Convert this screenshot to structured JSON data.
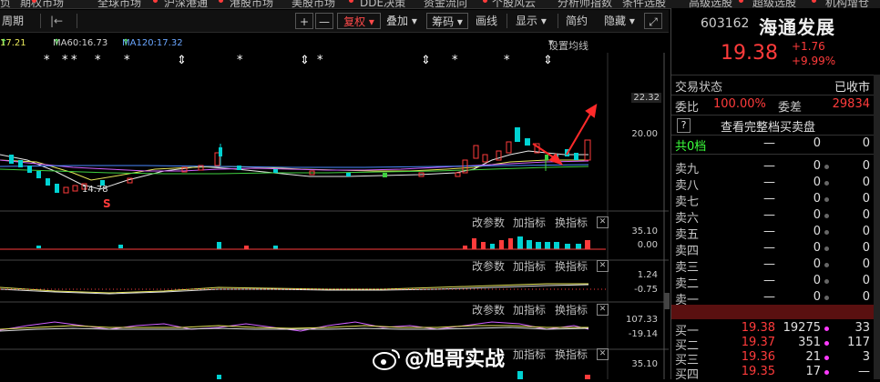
{
  "colors": {
    "up": "#ff3b3b",
    "down": "#00d2d2",
    "bg": "#000000",
    "accent": "#ff3b3b",
    "fall": "#3bff3b"
  },
  "top_nav": {
    "items": [
      "负",
      "期权市场",
      "全球市场",
      "沪深港通",
      "港股市场",
      "美股市场",
      "DDE决策",
      "资金流向",
      "个股风云",
      "分析师指数",
      "条件选股",
      "高级选股",
      "超级选股",
      "机构增仓"
    ]
  },
  "toolbar": {
    "period": "周期",
    "prev": "|←",
    "plus": "+",
    "minus": "—",
    "fuquan": "复权",
    "diejia": "叠加",
    "choumа": "筹码",
    "huaxian": "画线",
    "xianshi": "显示",
    "jianyue": "简约",
    "yincang": "隐藏",
    "expand_icon": "expand-icon"
  },
  "ma_line": {
    "ma_x_value": "17.21",
    "ma60": "MA60:16.73",
    "ma120": "MA120:17.32",
    "settings": "设置均线"
  },
  "chart": {
    "price_labels": [
      "22.32",
      "20.00"
    ],
    "markers_star": "*",
    "s_marker": "S",
    "low_label": "14.78",
    "panels": [
      {
        "menu": [
          "改参数",
          "加指标",
          "换指标"
        ],
        "labels": [
          "35.10",
          "0.00"
        ]
      },
      {
        "menu": [
          "改参数",
          "加指标",
          "换指标"
        ],
        "labels": [
          "1.24",
          "-0.75"
        ]
      },
      {
        "menu": [
          "改参数",
          "加指标",
          "换指标"
        ],
        "labels": [
          "107.33",
          "-19.14"
        ]
      },
      {
        "menu": [
          "加指标",
          "换指标"
        ],
        "labels": [
          "35.10"
        ]
      }
    ]
  },
  "quote": {
    "code": "603162",
    "name": "海通发展",
    "price": "19.38",
    "change": "+1.76",
    "change_pct": "+9.99%",
    "status_label": "交易状态",
    "status_value": "已收市",
    "weibi_label": "委比",
    "weibi_value": "100.00%",
    "weicha_label": "委差",
    "weicha_value": "29834",
    "help": "?",
    "full_book": "查看完整档买卖盘",
    "total_levels": "共0档",
    "total_dash": "—",
    "total_a": "0",
    "total_b": "0",
    "sell": [
      {
        "label": "卖九",
        "price": "—",
        "vol": "0",
        "cnt": "0"
      },
      {
        "label": "卖八",
        "price": "—",
        "vol": "0",
        "cnt": "0"
      },
      {
        "label": "卖七",
        "price": "—",
        "vol": "0",
        "cnt": "0"
      },
      {
        "label": "卖六",
        "price": "—",
        "vol": "0",
        "cnt": "0"
      },
      {
        "label": "卖五",
        "price": "—",
        "vol": "0",
        "cnt": "0"
      },
      {
        "label": "卖四",
        "price": "—",
        "vol": "0",
        "cnt": "0"
      },
      {
        "label": "卖三",
        "price": "—",
        "vol": "0",
        "cnt": "0"
      },
      {
        "label": "卖二",
        "price": "—",
        "vol": "0",
        "cnt": "0"
      },
      {
        "label": "卖一",
        "price": "—",
        "vol": "0",
        "cnt": "0"
      }
    ],
    "buy": [
      {
        "label": "买一",
        "price": "19.38",
        "vol": "19275",
        "cnt": "33"
      },
      {
        "label": "买二",
        "price": "19.37",
        "vol": "351",
        "cnt": "117"
      },
      {
        "label": "买三",
        "price": "19.36",
        "vol": "21",
        "cnt": "3"
      },
      {
        "label": "买四",
        "price": "19.35",
        "vol": "17",
        "cnt": "—"
      }
    ]
  },
  "watermark": "@旭哥实战"
}
